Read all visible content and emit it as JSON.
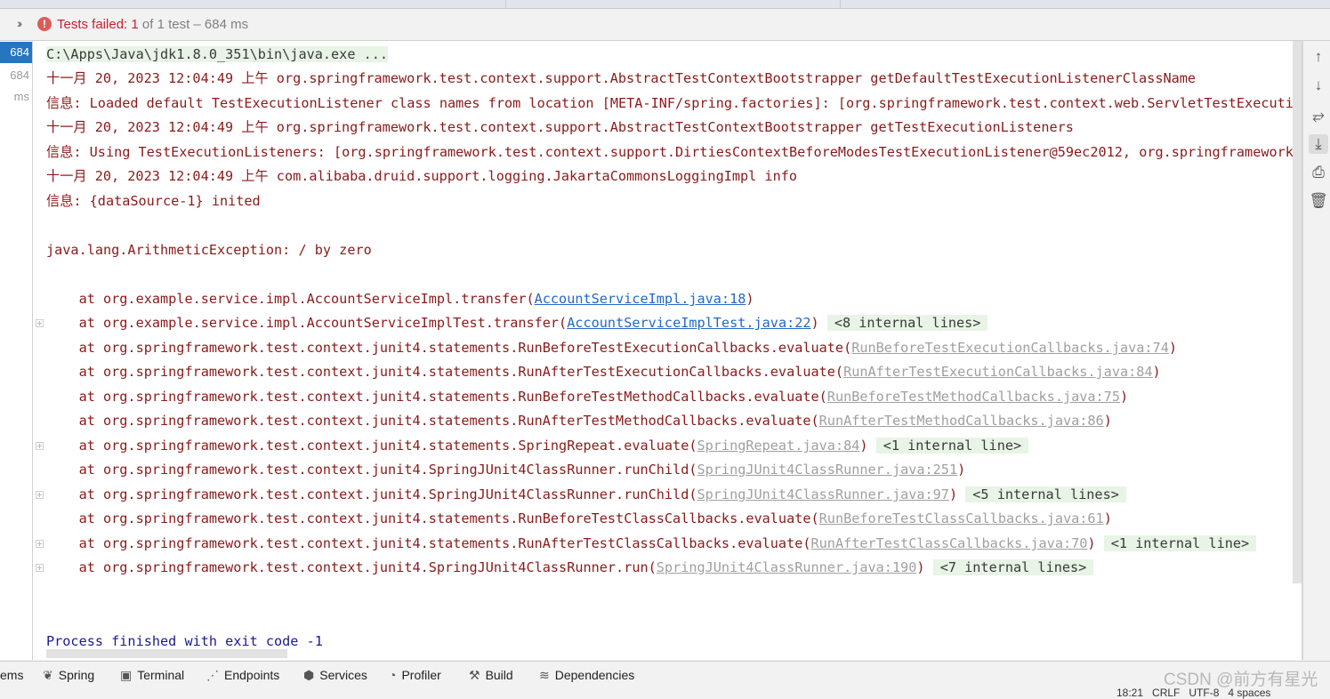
{
  "test_bar": {
    "expand_icon": "chevrons-right-icon",
    "status_icon": "error-icon",
    "failed_label": "Tests failed: ",
    "failed_count": "1",
    "rest": " of 1 test – 684 ms"
  },
  "test_tree": {
    "items": [
      {
        "duration": "684 ms",
        "selected": true
      },
      {
        "duration": "684 ms",
        "selected": false
      }
    ]
  },
  "console": {
    "command": "C:\\Apps\\Java\\jdk1.8.0_351\\bin\\java.exe ...",
    "log_lines": [
      "十一月 20, 2023 12:04:49 上午 org.springframework.test.context.support.AbstractTestContextBootstrapper getDefaultTestExecutionListenerClassName",
      "信息: Loaded default TestExecutionListener class names from location [META-INF/spring.factories]: [org.springframework.test.context.web.ServletTestExecutionListener",
      "十一月 20, 2023 12:04:49 上午 org.springframework.test.context.support.AbstractTestContextBootstrapper getTestExecutionListeners",
      "信息: Using TestExecutionListeners: [org.springframework.test.context.support.DirtiesContextBeforeModesTestExecutionListener@59ec2012, org.springframework",
      "十一月 20, 2023 12:04:49 上午 com.alibaba.druid.support.logging.JakartaCommonsLoggingImpl info",
      "信息: {dataSource-1} inited"
    ],
    "exception": "java.lang.ArithmeticException: / by zero",
    "stack": [
      {
        "prefix": "    at org.example.service.impl.AccountServiceImpl.transfer(",
        "link": "AccountServiceImpl.java:18",
        "link_style": "blue",
        "suffix": ")",
        "internal": "",
        "foldable": false
      },
      {
        "prefix": "    at org.example.service.impl.AccountServiceImplTest.transfer(",
        "link": "AccountServiceImplTest.java:22",
        "link_style": "blue",
        "suffix": ")",
        "internal": "<8 internal lines>",
        "foldable": true
      },
      {
        "prefix": "    at org.springframework.test.context.junit4.statements.RunBeforeTestExecutionCallbacks.evaluate(",
        "link": "RunBeforeTestExecutionCallbacks.java:74",
        "link_style": "gray",
        "suffix": ")",
        "internal": "",
        "foldable": false
      },
      {
        "prefix": "    at org.springframework.test.context.junit4.statements.RunAfterTestExecutionCallbacks.evaluate(",
        "link": "RunAfterTestExecutionCallbacks.java:84",
        "link_style": "gray",
        "suffix": ")",
        "internal": "",
        "foldable": false
      },
      {
        "prefix": "    at org.springframework.test.context.junit4.statements.RunBeforeTestMethodCallbacks.evaluate(",
        "link": "RunBeforeTestMethodCallbacks.java:75",
        "link_style": "gray",
        "suffix": ")",
        "internal": "",
        "foldable": false
      },
      {
        "prefix": "    at org.springframework.test.context.junit4.statements.RunAfterTestMethodCallbacks.evaluate(",
        "link": "RunAfterTestMethodCallbacks.java:86",
        "link_style": "gray",
        "suffix": ")",
        "internal": "",
        "foldable": false
      },
      {
        "prefix": "    at org.springframework.test.context.junit4.statements.SpringRepeat.evaluate(",
        "link": "SpringRepeat.java:84",
        "link_style": "gray",
        "suffix": ")",
        "internal": "<1 internal line>",
        "foldable": true
      },
      {
        "prefix": "    at org.springframework.test.context.junit4.SpringJUnit4ClassRunner.runChild(",
        "link": "SpringJUnit4ClassRunner.java:251",
        "link_style": "gray",
        "suffix": ")",
        "internal": "",
        "foldable": false
      },
      {
        "prefix": "    at org.springframework.test.context.junit4.SpringJUnit4ClassRunner.runChild(",
        "link": "SpringJUnit4ClassRunner.java:97",
        "link_style": "gray",
        "suffix": ")",
        "internal": "<5 internal lines>",
        "foldable": true
      },
      {
        "prefix": "    at org.springframework.test.context.junit4.statements.RunBeforeTestClassCallbacks.evaluate(",
        "link": "RunBeforeTestClassCallbacks.java:61",
        "link_style": "gray",
        "suffix": ")",
        "internal": "",
        "foldable": false
      },
      {
        "prefix": "    at org.springframework.test.context.junit4.statements.RunAfterTestClassCallbacks.evaluate(",
        "link": "RunAfterTestClassCallbacks.java:70",
        "link_style": "gray",
        "suffix": ")",
        "internal": "<1 internal line>",
        "foldable": true
      },
      {
        "prefix": "    at org.springframework.test.context.junit4.SpringJUnit4ClassRunner.run(",
        "link": "SpringJUnit4ClassRunner.java:190",
        "link_style": "gray",
        "suffix": ")",
        "internal": "<7 internal lines>",
        "foldable": true
      }
    ],
    "exit_message": "Process finished with exit code -1"
  },
  "right_toolbar": [
    {
      "name": "scroll-up-icon",
      "glyph": "↑",
      "active": false
    },
    {
      "name": "scroll-down-icon",
      "glyph": "↓",
      "active": false
    },
    {
      "name": "soft-wrap-icon",
      "glyph": "⥂",
      "active": false
    },
    {
      "name": "scroll-to-end-icon",
      "glyph": "⤓",
      "active": true
    },
    {
      "name": "print-icon",
      "glyph": "⎙",
      "active": false
    },
    {
      "name": "trash-icon",
      "glyph": "🗑",
      "active": false
    }
  ],
  "bottom_tabs": [
    {
      "label": "ems",
      "icon": ""
    },
    {
      "label": "Spring",
      "icon": "spring-leaf-icon"
    },
    {
      "label": "Terminal",
      "icon": "terminal-icon"
    },
    {
      "label": "Endpoints",
      "icon": "endpoints-icon"
    },
    {
      "label": "Services",
      "icon": "services-icon"
    },
    {
      "label": "Profiler",
      "icon": "profiler-icon"
    },
    {
      "label": "Build",
      "icon": "hammer-icon"
    },
    {
      "label": "Dependencies",
      "icon": "layers-icon"
    }
  ],
  "status_bar": {
    "position": "18:21   CRLF   UTF-8   4 spaces"
  },
  "watermark": "CSDN @前方有星光"
}
